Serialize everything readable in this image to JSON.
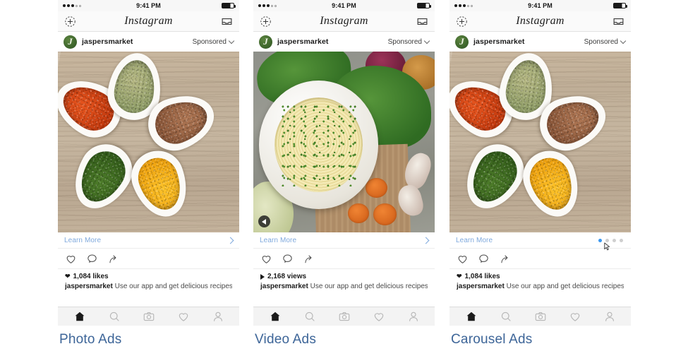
{
  "status_bar": {
    "signal_dots_filled": 3,
    "signal_dots_empty": 2,
    "time": "9:41 PM",
    "battery_icon": "battery-icon"
  },
  "app": {
    "logo_text": "Instagram",
    "add_icon": "add-photo-icon",
    "inbox_icon": "inbox-icon"
  },
  "account": {
    "name": "jaspersmarket",
    "sponsored_label": "Sponsored",
    "avatar_glyph": "J",
    "avatar_color": "#41692e",
    "chevron_icon": "chevron-down-icon"
  },
  "cta": {
    "learn_more_label": "Learn More",
    "chevron_icon": "chevron-right-icon",
    "link_color": "#7fa9dd"
  },
  "actions": {
    "like_icon": "heart-icon",
    "comment_icon": "comment-bubble-icon",
    "share_icon": "share-arrow-icon"
  },
  "tabbar": {
    "items": [
      {
        "icon": "home-icon",
        "active": true
      },
      {
        "icon": "search-icon",
        "active": false
      },
      {
        "icon": "camera-icon",
        "active": false
      },
      {
        "icon": "heart-icon",
        "active": false
      },
      {
        "icon": "profile-icon",
        "active": false
      }
    ]
  },
  "carousel": {
    "dot_count": 4,
    "active_index": 0,
    "active_color": "#3897f0",
    "inactive_color": "#cfcfcf",
    "cursor_icon": "mouse-cursor-icon"
  },
  "video": {
    "sound_icon": "speaker-icon",
    "play_icon": "play-triangle-icon"
  },
  "caption": {
    "author": "jaspersmarket",
    "text": " Use our app and get delicious recipes"
  },
  "phones": [
    {
      "id": "photo",
      "media_kind": "spice-bowls-photo",
      "stat_prefix_icon": "heart-filled-icon",
      "stat_text": "1,084 likes",
      "label": "Photo Ads"
    },
    {
      "id": "video",
      "media_kind": "pasta-bowl-video",
      "stat_prefix_icon": "play-triangle-icon",
      "stat_text": "2,168 views",
      "label": "Video Ads"
    },
    {
      "id": "carousel",
      "media_kind": "spice-bowls-photo",
      "stat_prefix_icon": "heart-filled-icon",
      "stat_text": "1,084 likes",
      "label": "Carousel Ads"
    }
  ]
}
